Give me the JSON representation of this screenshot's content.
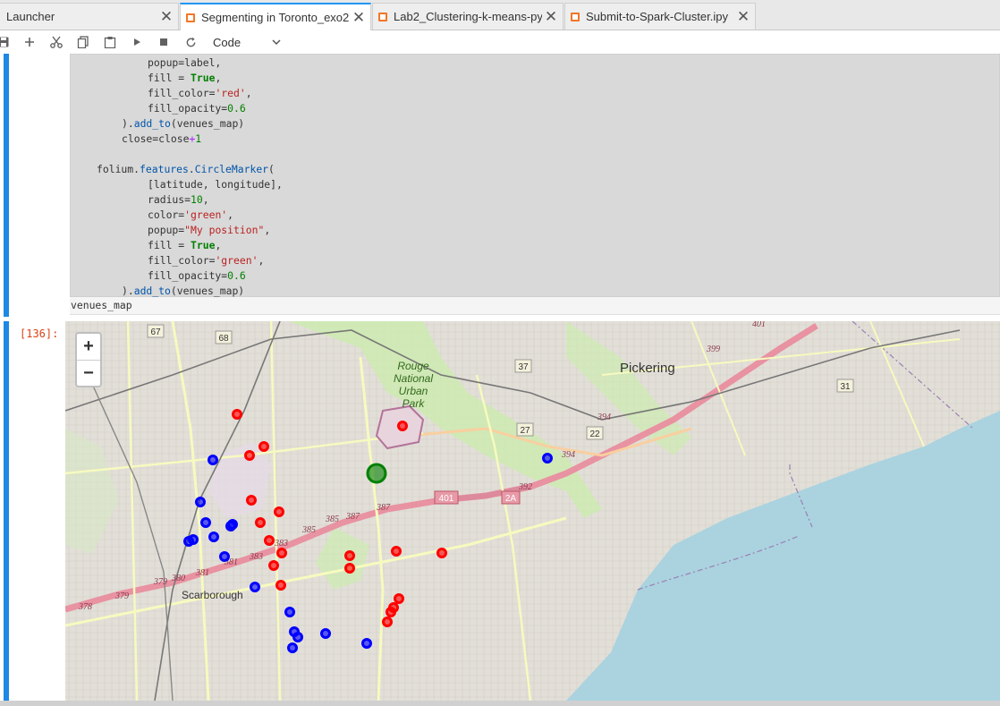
{
  "tabs": [
    {
      "label": "Launcher",
      "active": false
    },
    {
      "label": "Segmenting in Toronto_exo2",
      "active": true
    },
    {
      "label": "Lab2_Clustering-k-means-py",
      "active": false
    },
    {
      "label": "Submit-to-Spark-Cluster.ipy",
      "active": false
    }
  ],
  "toolbar": {
    "save_icon": "save-icon",
    "add_icon": "plus-icon",
    "cut_icon": "scissors-icon",
    "copy_icon": "copy-icon",
    "paste_icon": "paste-icon",
    "run_icon": "run-icon",
    "stop_icon": "stop-icon",
    "restart_icon": "restart-icon",
    "cell_type": "Code"
  },
  "code": {
    "lines": [
      "popup=label,",
      "fill = True,",
      "fill_color='red',",
      "fill_opacity=0.6",
      ").add_to(venues_map)",
      "close=close+1",
      "",
      "folium.features.CircleMarker(",
      "[latitude, longitude],",
      "radius=10,",
      "color='green',",
      "popup=\"My position\",",
      "fill = True,",
      "fill_color='green',",
      "fill_opacity=0.6",
      ").add_to(venues_map)"
    ],
    "last_line": "venues_map"
  },
  "output": {
    "prompt": "[136]:",
    "zoom_in": "+",
    "zoom_out": "−",
    "map_labels": {
      "park": [
        "Rouge",
        "National",
        "Urban",
        "Park"
      ],
      "pickering": "Pickering",
      "scarborough": "Scarborough"
    },
    "route_shields": [
      "67",
      "68",
      "37",
      "31",
      "27",
      "22",
      "401",
      "2A"
    ],
    "road_numbers": [
      "401",
      "399",
      "394",
      "394",
      "392",
      "387",
      "387",
      "385",
      "385",
      "383",
      "383",
      "381",
      "381",
      "380",
      "379",
      "379",
      "378"
    ],
    "colors": {
      "red_marker": "#ff0000",
      "blue_marker": "#0000ff",
      "green_marker": "#008000",
      "water": "#aad3df",
      "accent": "#2196f3"
    }
  }
}
